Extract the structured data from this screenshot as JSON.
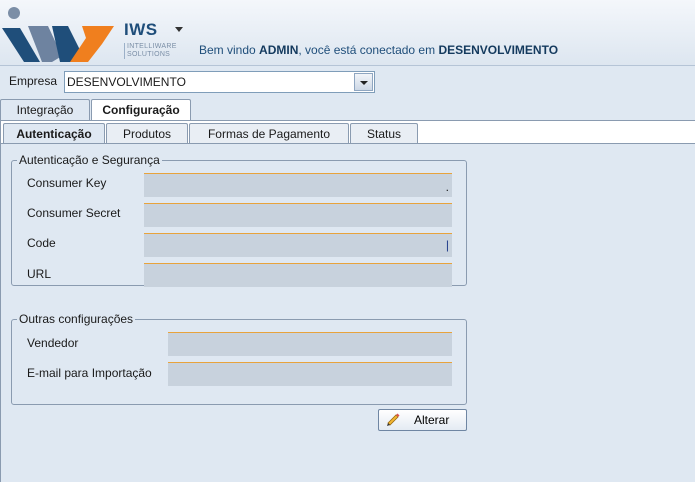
{
  "header": {
    "brand": "IWS",
    "brand_sub_1": "INTELLIWARE",
    "brand_sub_2": "SOLUTIONS",
    "welcome_prefix": "Bem vindo ",
    "user": "ADMIN",
    "welcome_middle": ", você está conectado em ",
    "environment": "DESENVOLVIMENTO"
  },
  "empresa": {
    "label": "Empresa",
    "selected": "DESENVOLVIMENTO"
  },
  "tabs_top": [
    "Integração",
    "Configuração"
  ],
  "tabs_sub": [
    "Autenticação",
    "Produtos",
    "Formas de Pagamento",
    "Status"
  ],
  "auth_group": {
    "title": "Autenticação e Segurança",
    "consumer_key_label": "Consumer Key",
    "consumer_key_value": ".",
    "consumer_secret_label": "Consumer Secret",
    "code_label": "Code",
    "code_value": "|",
    "url_label": "URL"
  },
  "other_group": {
    "title": "Outras configurações",
    "vendedor_label": "Vendedor",
    "email_label": "E-mail para Importação"
  },
  "alterar_button": "Alterar",
  "colors": {
    "accent_orange": "#e8a33c",
    "brand_blue": "#1f4e7a",
    "panel_bg": "#dfe8f2"
  }
}
